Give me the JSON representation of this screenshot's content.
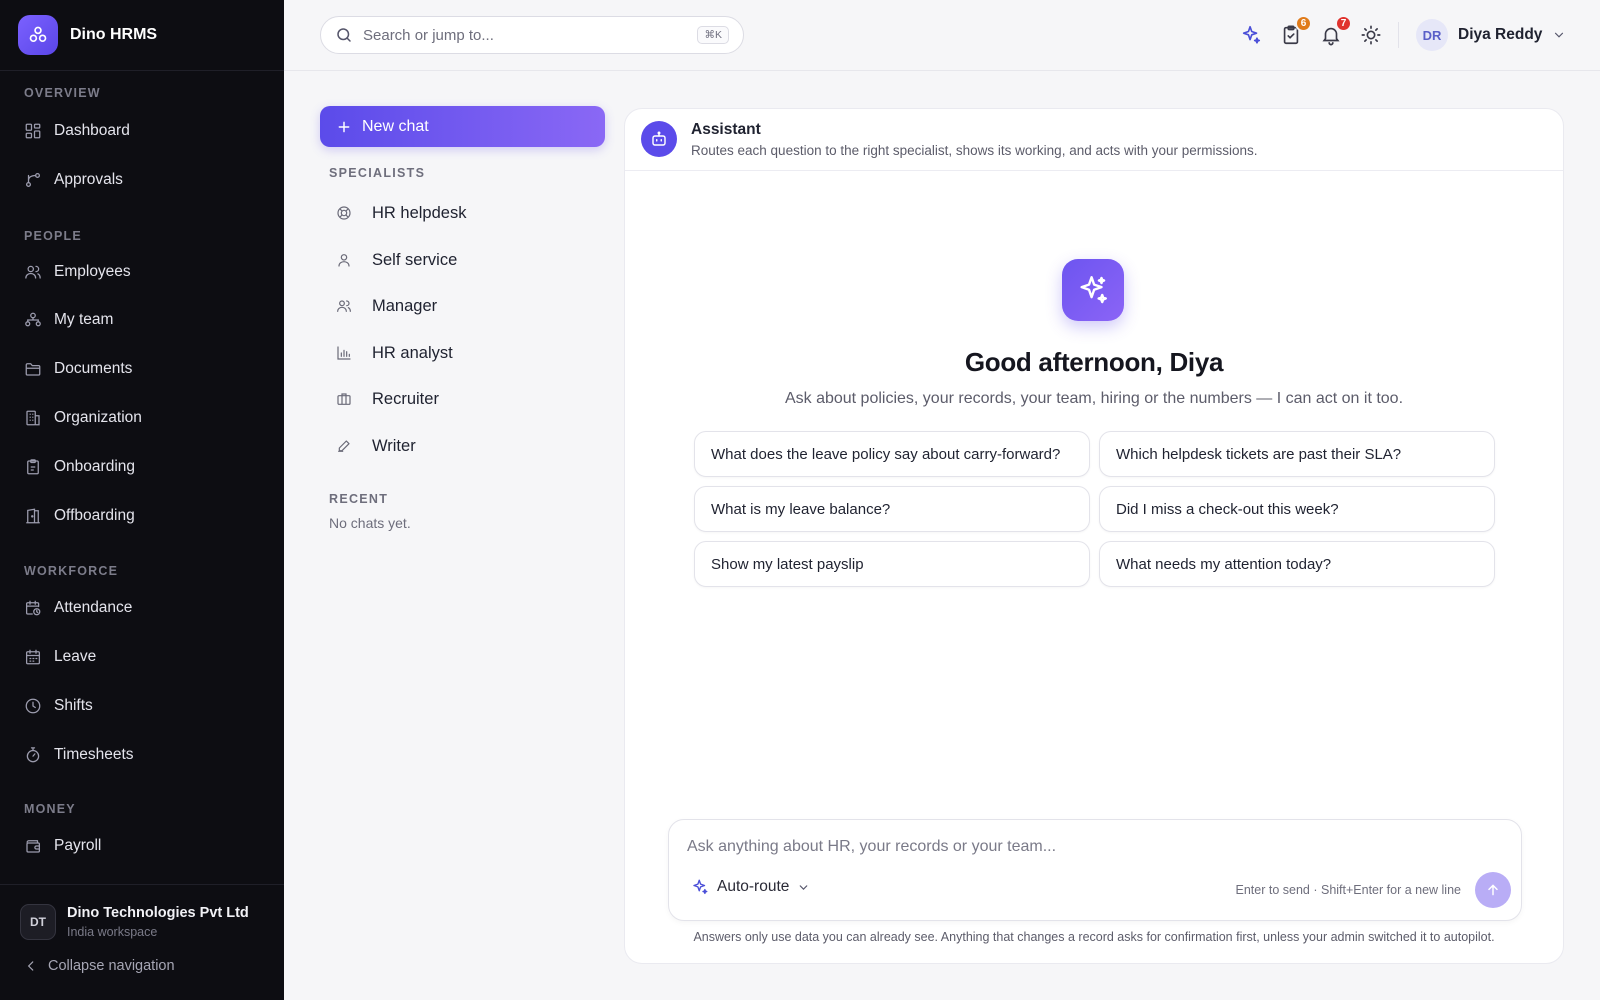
{
  "app": {
    "name": "Dino HRMS"
  },
  "sidebar": {
    "sections": [
      {
        "label": "OVERVIEW",
        "items": [
          {
            "label": "Dashboard",
            "icon": "dashboard-icon"
          },
          {
            "label": "Approvals",
            "icon": "approvals-icon"
          }
        ]
      },
      {
        "label": "PEOPLE",
        "items": [
          {
            "label": "Employees",
            "icon": "employees-icon"
          },
          {
            "label": "My team",
            "icon": "team-icon"
          },
          {
            "label": "Documents",
            "icon": "folder-icon"
          },
          {
            "label": "Organization",
            "icon": "building-icon"
          },
          {
            "label": "Onboarding",
            "icon": "clipboard-icon"
          },
          {
            "label": "Offboarding",
            "icon": "door-icon"
          }
        ]
      },
      {
        "label": "WORKFORCE",
        "items": [
          {
            "label": "Attendance",
            "icon": "calendar-clock-icon"
          },
          {
            "label": "Leave",
            "icon": "calendar-icon"
          },
          {
            "label": "Shifts",
            "icon": "clock-icon"
          },
          {
            "label": "Timesheets",
            "icon": "stopwatch-icon"
          }
        ]
      },
      {
        "label": "MONEY",
        "items": [
          {
            "label": "Payroll",
            "icon": "wallet-icon"
          }
        ]
      }
    ],
    "workspace": {
      "initials": "DT",
      "name": "Dino Technologies Pvt Ltd",
      "subtitle": "India workspace"
    },
    "collapse_label": "Collapse navigation"
  },
  "topbar": {
    "search": {
      "placeholder": "Search or jump to...",
      "shortcut": "⌘K"
    },
    "tasks_badge": "6",
    "notifications_badge": "7",
    "user": {
      "initials": "DR",
      "name": "Diya Reddy"
    },
    "colors": {
      "tasks_badge": "#e07b1a",
      "notifications_badge": "#e0332e"
    }
  },
  "chat_panel": {
    "new_chat_label": "New chat",
    "specialists_heading": "SPECIALISTS",
    "specialists": [
      {
        "label": "HR helpdesk",
        "icon": "lifebuoy-icon"
      },
      {
        "label": "Self service",
        "icon": "user-icon"
      },
      {
        "label": "Manager",
        "icon": "users-icon"
      },
      {
        "label": "HR analyst",
        "icon": "bar-chart-icon"
      },
      {
        "label": "Recruiter",
        "icon": "briefcase-icon"
      },
      {
        "label": "Writer",
        "icon": "pen-icon"
      }
    ],
    "recent_heading": "RECENT",
    "recent_empty": "No chats yet."
  },
  "assistant": {
    "title": "Assistant",
    "subtitle": "Routes each question to the right specialist, shows its working, and acts with your permissions.",
    "greeting": "Good afternoon, Diya",
    "intro": "Ask about policies, your records, your team, hiring or the numbers — I can act on it too.",
    "suggestions": [
      "What does the leave policy say about carry-forward?",
      "Which helpdesk tickets are past their SLA?",
      "What is my leave balance?",
      "Did I miss a check-out this week?",
      "Show my latest payslip",
      "What needs my attention today?"
    ],
    "composer": {
      "placeholder": "Ask anything about HR, your records or your team...",
      "route_label": "Auto-route",
      "hint": "Enter to send · Shift+Enter for a new line"
    },
    "disclaimer": "Answers only use data you can already see. Anything that changes a record asks for confirmation first, unless your admin switched it to autopilot."
  },
  "colors": {
    "accent": "#5b4bea",
    "sidebar_bg": "#0d0d12"
  }
}
